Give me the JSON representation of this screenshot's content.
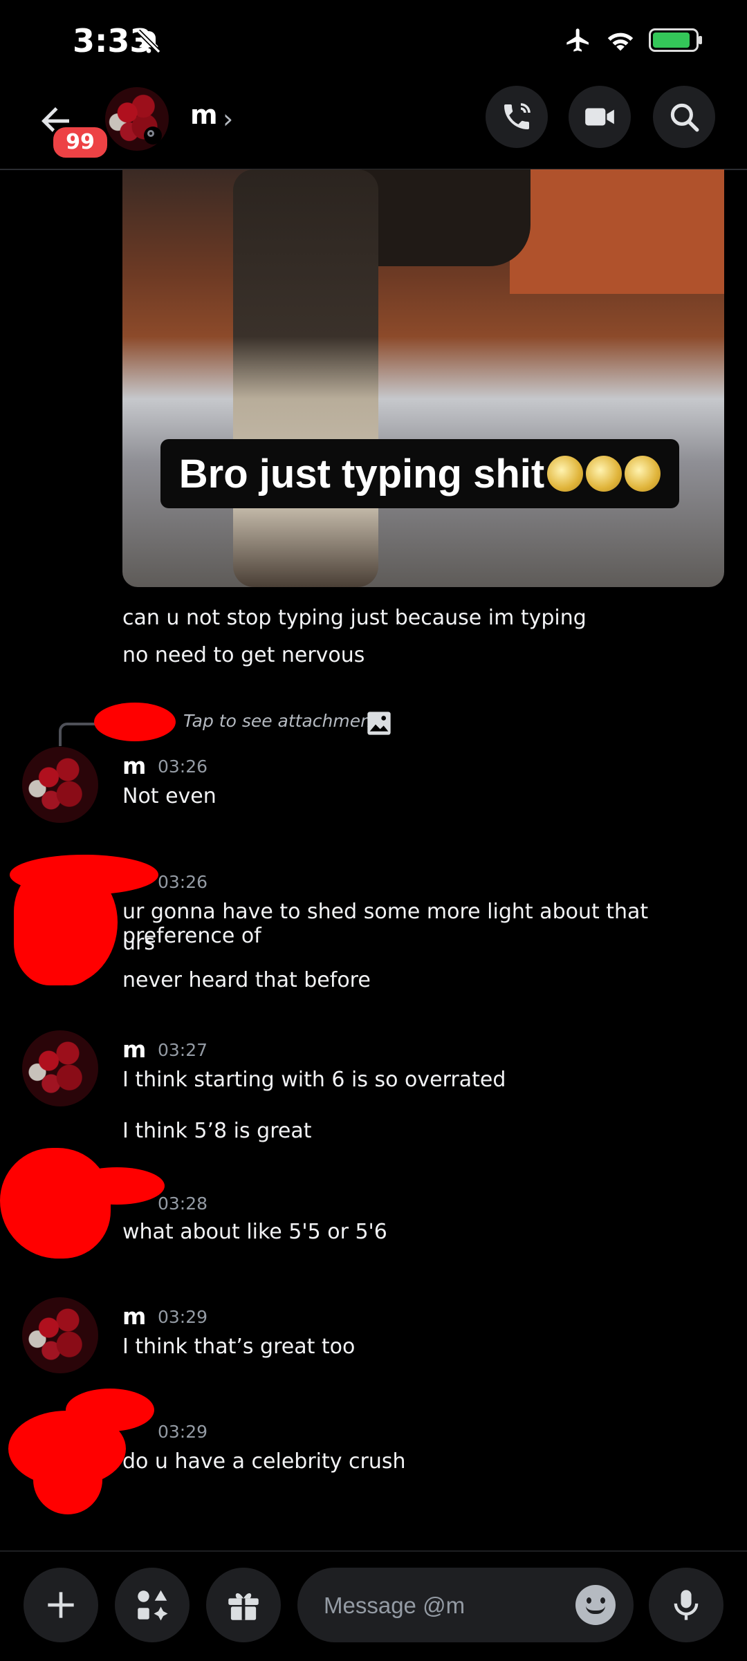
{
  "status_bar": {
    "time": "3:33"
  },
  "header": {
    "unread_badge": "99",
    "title": "m",
    "chevron": "›"
  },
  "image_caption": "Bro just typing shit",
  "messages": [
    {
      "text": "can u not stop typing just because im typing"
    },
    {
      "text": "no need to get nervous"
    }
  ],
  "reply_preview": "Tap to see attachment",
  "groups": [
    {
      "author": "m",
      "time": "03:26",
      "lines": [
        "Not even"
      ]
    },
    {
      "author": "",
      "time": "03:26",
      "lines": [
        "ur gonna have to shed some more light about that preference of",
        "urs",
        "never heard that before"
      ]
    },
    {
      "author": "m",
      "time": "03:27",
      "lines": [
        "I think starting with 6 is so overrated",
        "I think 5’8 is great"
      ]
    },
    {
      "author": "",
      "time": "03:28",
      "lines": [
        "what about like 5'5 or 5'6"
      ]
    },
    {
      "author": "m",
      "time": "03:29",
      "lines": [
        "I think that’s great too"
      ]
    },
    {
      "author": "",
      "time": "03:29",
      "lines": [
        "do u have a celebrity crush"
      ]
    }
  ],
  "composer": {
    "placeholder": "Message @m"
  },
  "colors": {
    "background": "#000000",
    "badge": "#ed4245",
    "surface": "#1e1f22",
    "muted": "#949ba4"
  }
}
